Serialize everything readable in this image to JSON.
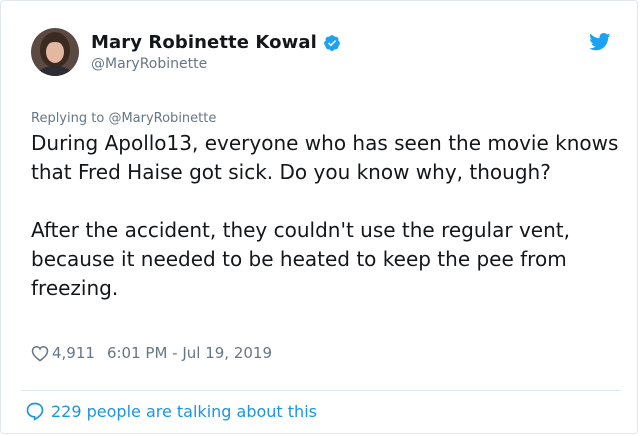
{
  "author": {
    "name": "Mary Robinette Kowal",
    "handle": "@MaryRobinette",
    "verified": true
  },
  "reply": {
    "prefix": "Replying to",
    "mention": "@MaryRobinette"
  },
  "tweet": {
    "paragraphs": [
      "During Apollo13, everyone who has seen the movie knows that Fred Haise got sick. Do you know why, though?",
      "After the accident, they couldn't use the regular vent, because it needed to be heated to keep the pee from freezing."
    ],
    "likes": "4,911",
    "timestamp": "6:01 PM - Jul 19, 2019"
  },
  "footer": {
    "talking_label": "229 people are talking about this"
  },
  "icons": {
    "verified": "verified-badge-icon",
    "bird": "twitter-bird-icon",
    "heart": "heart-icon",
    "speech": "speech-bubble-icon"
  },
  "colors": {
    "accent": "#1da1f2",
    "link": "#1b95e0",
    "muted": "#657786",
    "text": "#14171a",
    "border": "#e1e8ed"
  }
}
